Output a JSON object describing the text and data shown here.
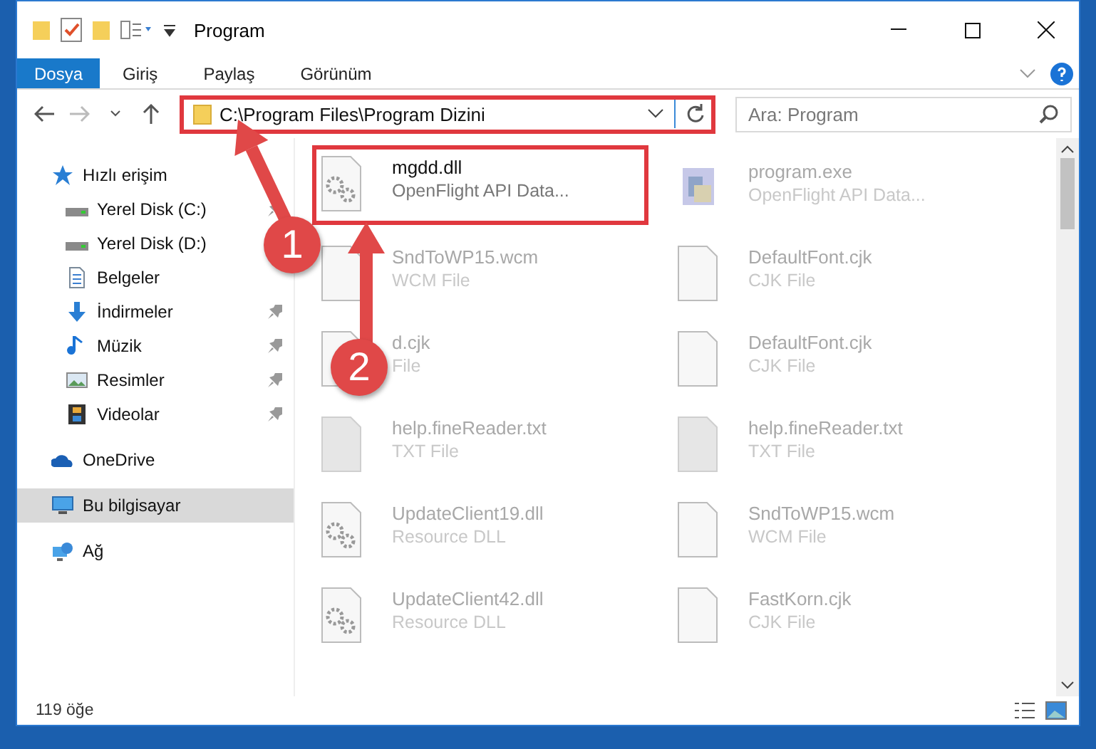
{
  "window": {
    "title": "Program"
  },
  "ribbon": {
    "tabs": [
      {
        "label": "Dosya",
        "selected": true
      },
      {
        "label": "Giriş",
        "selected": false
      },
      {
        "label": "Paylaş",
        "selected": false
      },
      {
        "label": "Görünüm",
        "selected": false
      }
    ]
  },
  "address_bar": {
    "path": "C:\\Program Files\\Program Dizini",
    "highlighted": true
  },
  "search": {
    "placeholder": "Ara: Program"
  },
  "sidebar": {
    "items": [
      {
        "label": "Hızlı erişim",
        "selected": false,
        "children": [
          {
            "label": "Yerel Disk (C:)",
            "pinned": true
          },
          {
            "label": "Yerel Disk (D:)",
            "pinned": false
          },
          {
            "label": "Belgeler",
            "pinned": false
          },
          {
            "label": "İndirmeler",
            "pinned": true
          },
          {
            "label": "Müzik",
            "pinned": true
          },
          {
            "label": "Resimler",
            "pinned": true
          },
          {
            "label": "Videolar",
            "pinned": true
          }
        ]
      },
      {
        "label": "OneDrive",
        "selected": false
      },
      {
        "label": "Bu bilgisayar",
        "selected": true
      },
      {
        "label": "Ağ",
        "selected": false
      }
    ]
  },
  "files": [
    {
      "name": "mgdd.dll",
      "type": "OpenFlight API Data...",
      "kind": "dll",
      "highlighted": true
    },
    {
      "name": "program.exe",
      "type": "OpenFlight API Data...",
      "kind": "exe",
      "highlighted": false
    },
    {
      "name": "SndToWP15.wcm",
      "type": "WCM File",
      "kind": "blank",
      "highlighted": false
    },
    {
      "name": "DefaultFont.cjk",
      "type": "CJK File",
      "kind": "blank",
      "highlighted": false
    },
    {
      "name": "d.cjk",
      "type": "File",
      "kind": "blank",
      "highlighted": false
    },
    {
      "name": "DefaultFont.cjk",
      "type": "CJK File",
      "kind": "blank",
      "highlighted": false
    },
    {
      "name": "help.fineReader.txt",
      "type": "TXT File",
      "kind": "txt",
      "highlighted": false
    },
    {
      "name": "help.fineReader.txt",
      "type": "TXT File",
      "kind": "txt",
      "highlighted": false
    },
    {
      "name": "UpdateClient19.dll",
      "type": "Resource DLL",
      "kind": "dll",
      "highlighted": false
    },
    {
      "name": "SndToWP15.wcm",
      "type": "WCM File",
      "kind": "blank",
      "highlighted": false
    },
    {
      "name": "UpdateClient42.dll",
      "type": "Resource DLL",
      "kind": "dll",
      "highlighted": false
    },
    {
      "name": "FastKorn.cjk",
      "type": "CJK File",
      "kind": "blank",
      "highlighted": false
    }
  ],
  "status_bar": {
    "count": "119 öğe"
  },
  "annotations": [
    {
      "kind": "marker",
      "label": "1"
    },
    {
      "kind": "marker",
      "label": "2"
    }
  ]
}
